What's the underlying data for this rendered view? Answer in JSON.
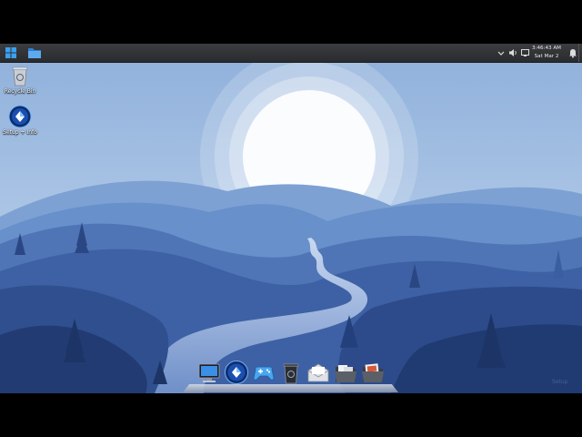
{
  "taskbar": {
    "start_icon": "windows-logo-icon",
    "pinned": [
      {
        "name": "file-explorer",
        "icon": "folder-icon"
      }
    ],
    "tray": {
      "icons": [
        "chevron-up-icon",
        "volume-icon",
        "network-icon",
        "notification-icon"
      ],
      "time": "3:46:43 AM",
      "date": "Sat Mar 2"
    }
  },
  "desktop": {
    "icons": [
      {
        "label": "Recycle Bin",
        "icon": "recycle-bin-icon"
      },
      {
        "label": "Setup + Info",
        "icon": "setup-orb-icon"
      }
    ]
  },
  "dock": {
    "items": [
      "computer-icon",
      "setup-orb-icon",
      "gamepad-icon",
      "recycle-bin-icon",
      "mail-icon",
      "documents-folder-icon",
      "pictures-folder-icon"
    ]
  },
  "wallpaper": {
    "sky": "#a9c5e4",
    "sun": "#ffffff",
    "hills": [
      "#7fa3d4",
      "#5a7fc0",
      "#3f63a6",
      "#2c4c8c",
      "#1f3a73"
    ],
    "river": "#a5bde4"
  },
  "watermark": "Setup"
}
